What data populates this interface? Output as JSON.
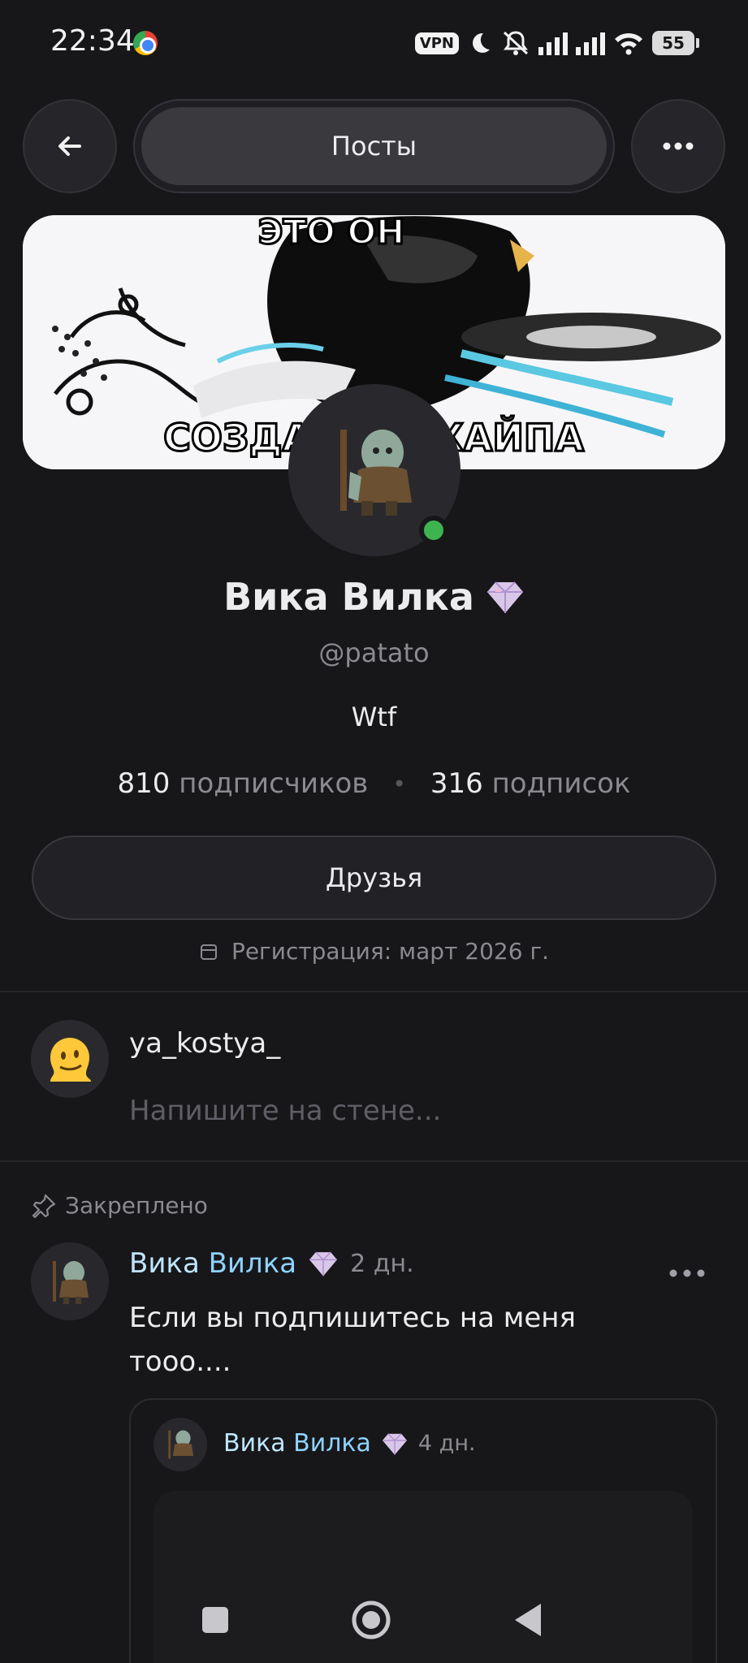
{
  "status_bar": {
    "time": "22:34",
    "vpn_label": "VPN",
    "battery": "55",
    "icons": [
      "chrome-icon",
      "vpn-icon",
      "moon-icon",
      "mute-icon",
      "signal-icon",
      "signal-icon",
      "wifi-icon",
      "battery-icon"
    ]
  },
  "nav": {
    "tab_label": "Посты",
    "back_icon": "arrow-left-icon",
    "more_icon": "more-horizontal-icon"
  },
  "banner": {
    "top_text": "ЭТО ОН",
    "bottom_text": "СОЗДАТЕЛЬ ХАЙПА"
  },
  "profile": {
    "name": "Вика Вилка",
    "handle": "@patato",
    "bio": "Wtf",
    "followers_count": "810",
    "followers_label": "подписчиков",
    "following_count": "316",
    "following_label": "подписок",
    "friends_button": "Друзья",
    "registration": "Регистрация: март 2026 г.",
    "online": true
  },
  "composer": {
    "username": "ya_kostya_",
    "placeholder": "Напишите на стене..."
  },
  "pinned_post": {
    "pinned_label": "Закреплено",
    "author_first": "Вика",
    "author_last": "Вилка",
    "time": "2 дн.",
    "text": "Если вы подпишитесь на меня тооо....",
    "repost": {
      "author_first": "Вика",
      "author_last": "Вилка",
      "time": "4 дн."
    }
  },
  "colors": {
    "background": "#17171a",
    "accent_name": "#8fd3ff",
    "online": "#3eb450"
  }
}
